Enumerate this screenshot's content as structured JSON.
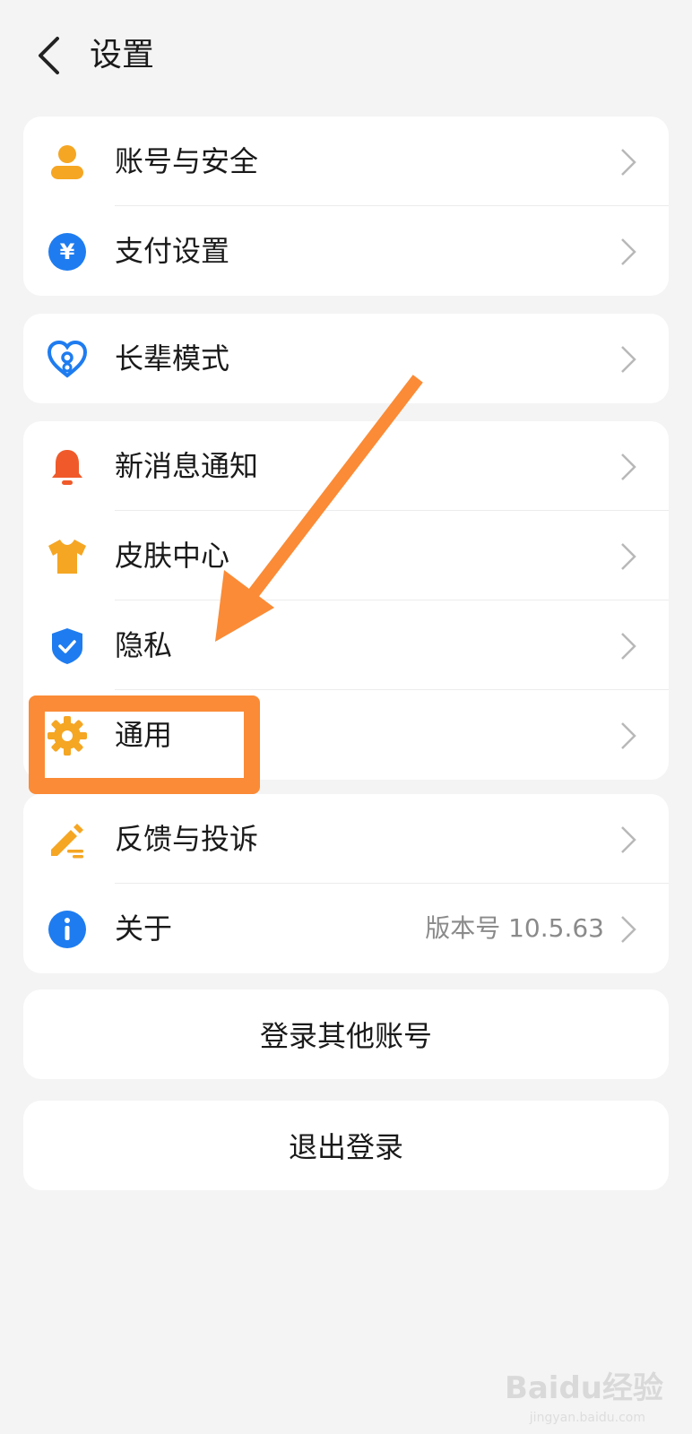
{
  "header": {
    "title": "设置"
  },
  "groups": [
    {
      "items": [
        {
          "label": "账号与安全",
          "icon": "user-icon",
          "color": "#f5a623"
        },
        {
          "label": "支付设置",
          "icon": "yuan-icon",
          "color": "#1e7cf0"
        }
      ]
    },
    {
      "items": [
        {
          "label": "长辈模式",
          "icon": "heart-icon",
          "color": "#1e7cf0"
        }
      ]
    },
    {
      "items": [
        {
          "label": "新消息通知",
          "icon": "bell-icon",
          "color": "#f05a2a"
        },
        {
          "label": "皮肤中心",
          "icon": "tshirt-icon",
          "color": "#f5a623"
        },
        {
          "label": "隐私",
          "icon": "shield-icon",
          "color": "#1e7cf0"
        },
        {
          "label": "通用",
          "icon": "gear-icon",
          "color": "#f5a623"
        }
      ]
    },
    {
      "items": [
        {
          "label": "反馈与投诉",
          "icon": "pencil-icon",
          "color": "#f5a623"
        },
        {
          "label": "关于",
          "icon": "info-icon",
          "color": "#1e7cf0",
          "value": "版本号 10.5.63"
        }
      ]
    }
  ],
  "actions": {
    "login_other": "登录其他账号",
    "logout": "退出登录"
  },
  "annotation": {
    "color": "#fb8b36"
  },
  "watermark": {
    "text": "Baidu经验",
    "sub": "jingyan.baidu.com"
  }
}
